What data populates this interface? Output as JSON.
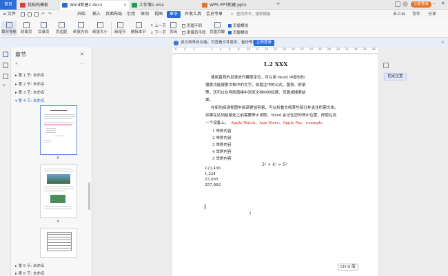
{
  "titlebar": {
    "home_label": "首页",
    "tabs": [
      {
        "label": "找稻壳模板",
        "color": "#e0403a"
      },
      {
        "label": "Word新建2.docx",
        "color": "#2b6dd6"
      },
      {
        "label": "工作簿1.xlsx",
        "color": "#1f9d55"
      },
      {
        "label": "WPS PPT新建.pptx",
        "color": "#e8742a"
      }
    ],
    "add_label": "+",
    "login_label": "立即登录"
  },
  "menubar": {
    "file_label": "≡ 文件",
    "items": [
      "开始",
      "插入",
      "页面布局",
      "引用",
      "审阅",
      "视图",
      "章节",
      "开发工具",
      "会员专享"
    ],
    "active_index": 6,
    "search_placeholder": "查找命令、搜索模板",
    "right_items": [
      "未上云",
      "协作",
      "分享"
    ]
  },
  "ribbon": {
    "buttons": [
      "章节导航",
      "封面页",
      "目录页",
      "页边距",
      "纸张方向",
      "纸张大小",
      "新增节",
      "删除本节",
      "上一节",
      "下一节",
      "页码",
      "页眉页脚"
    ],
    "checks": [
      {
        "label": "页眉不同",
        "on": false
      },
      {
        "label": "奇偶页不同",
        "on": false
      },
      {
        "label": "页眉横线",
        "on": true
      },
      {
        "label": "页脚横线",
        "on": true
      }
    ]
  },
  "notice": {
    "text": "该文档来自云端，可查看文件版本、备份等信息",
    "button": "立即登录"
  },
  "ruler": {
    "ticks": [
      "6",
      "4",
      "2",
      "",
      "2",
      "4",
      "6",
      "8",
      "10",
      "12",
      "14",
      "16",
      "18",
      "20",
      "22",
      "24",
      "26",
      "28",
      "30",
      "32",
      "34",
      "36",
      "38"
    ]
  },
  "nav": {
    "title": "章节",
    "chapters": [
      {
        "label": "▸ 第 1 节: 未命名",
        "active": false
      },
      {
        "label": "▸ 第 2 节: 未命名",
        "active": false
      },
      {
        "label": "▸ 第 3 节: 未命名",
        "active": false
      },
      {
        "label": "▾ 第 4 节: 未命名",
        "active": true
      },
      {
        "label": "▸ 第 5 节: 未命名",
        "active": false
      },
      {
        "label": "▸ 第 6 节: 未命名",
        "active": false
      }
    ],
    "page_numbers": [
      "3",
      "4"
    ]
  },
  "document": {
    "heading": "1.2 XXX",
    "para1": [
      "使用直观的目录进行模型定位，可以用 Word 中提供的",
      "搜索功能搜索文档中的文字，如题注中的公式、图表、附录",
      "等，还可以在导航窗格中浏览文档中的标题、页面或搜索结",
      "果。"
    ],
    "para2": [
      "在新的阅读视图中阅读更加容易，可以折叠文档某些部分并关注所需文本。",
      "如果在达到结尾处之前需要停止读取，Word 会记住您的停止位置，即使在另",
      "一个设备上。"
    ],
    "apps_line": [
      "Apple Watch",
      "App Store",
      "Apple Pay",
      "example"
    ],
    "list_items": [
      "1  举例内容",
      "2  举例内容",
      "3  举例内容",
      "4  举例内容",
      "5  举例内容"
    ],
    "equation": "3² + 4² = 5²",
    "numbers": [
      "123,456",
      "1,234",
      "23,465",
      "357,862"
    ],
    "ime_label": "CH ⊘ 简"
  },
  "right": {
    "label": "稻定位置"
  }
}
